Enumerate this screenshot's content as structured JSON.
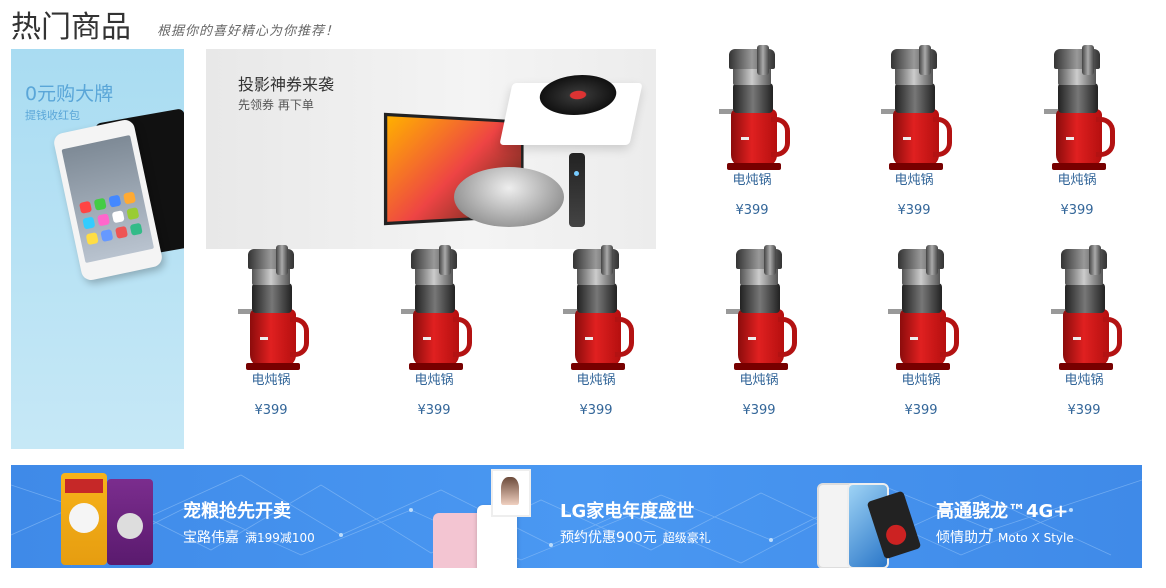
{
  "header": {
    "title": "热门商品",
    "subtitle": "根据你的喜好精心为你推荐！"
  },
  "left_promo": {
    "title": "0元购大牌",
    "subtitle": "提钱收红包"
  },
  "projector_banner": {
    "title": "投影神券来袭",
    "subtitle": "先领券 再下单"
  },
  "products": [
    {
      "name": "电炖锅",
      "price": "¥399"
    },
    {
      "name": "电炖锅",
      "price": "¥399"
    },
    {
      "name": "电炖锅",
      "price": "¥399"
    },
    {
      "name": "电炖锅",
      "price": "¥399"
    },
    {
      "name": "电炖锅",
      "price": "¥399"
    },
    {
      "name": "电炖锅",
      "price": "¥399"
    },
    {
      "name": "电炖锅",
      "price": "¥399"
    },
    {
      "name": "电炖锅",
      "price": "¥399"
    },
    {
      "name": "电炖锅",
      "price": "¥399"
    }
  ],
  "bottom_banner": {
    "promos": [
      {
        "title": "宠粮抢先开卖",
        "sub": "宝路伟嘉",
        "sub_small": "满199减100"
      },
      {
        "title": "LG家电年度盛世",
        "sub": "预约优惠900元",
        "sub_small": "超级豪礼"
      },
      {
        "title": "高通骁龙™4G+",
        "sub": "倾情助力",
        "sub_small": "Moto X Style"
      }
    ]
  },
  "colors": {
    "product_text": "#336699",
    "banner_blue": "#4a98f2",
    "juicer_red": "#e02020"
  }
}
